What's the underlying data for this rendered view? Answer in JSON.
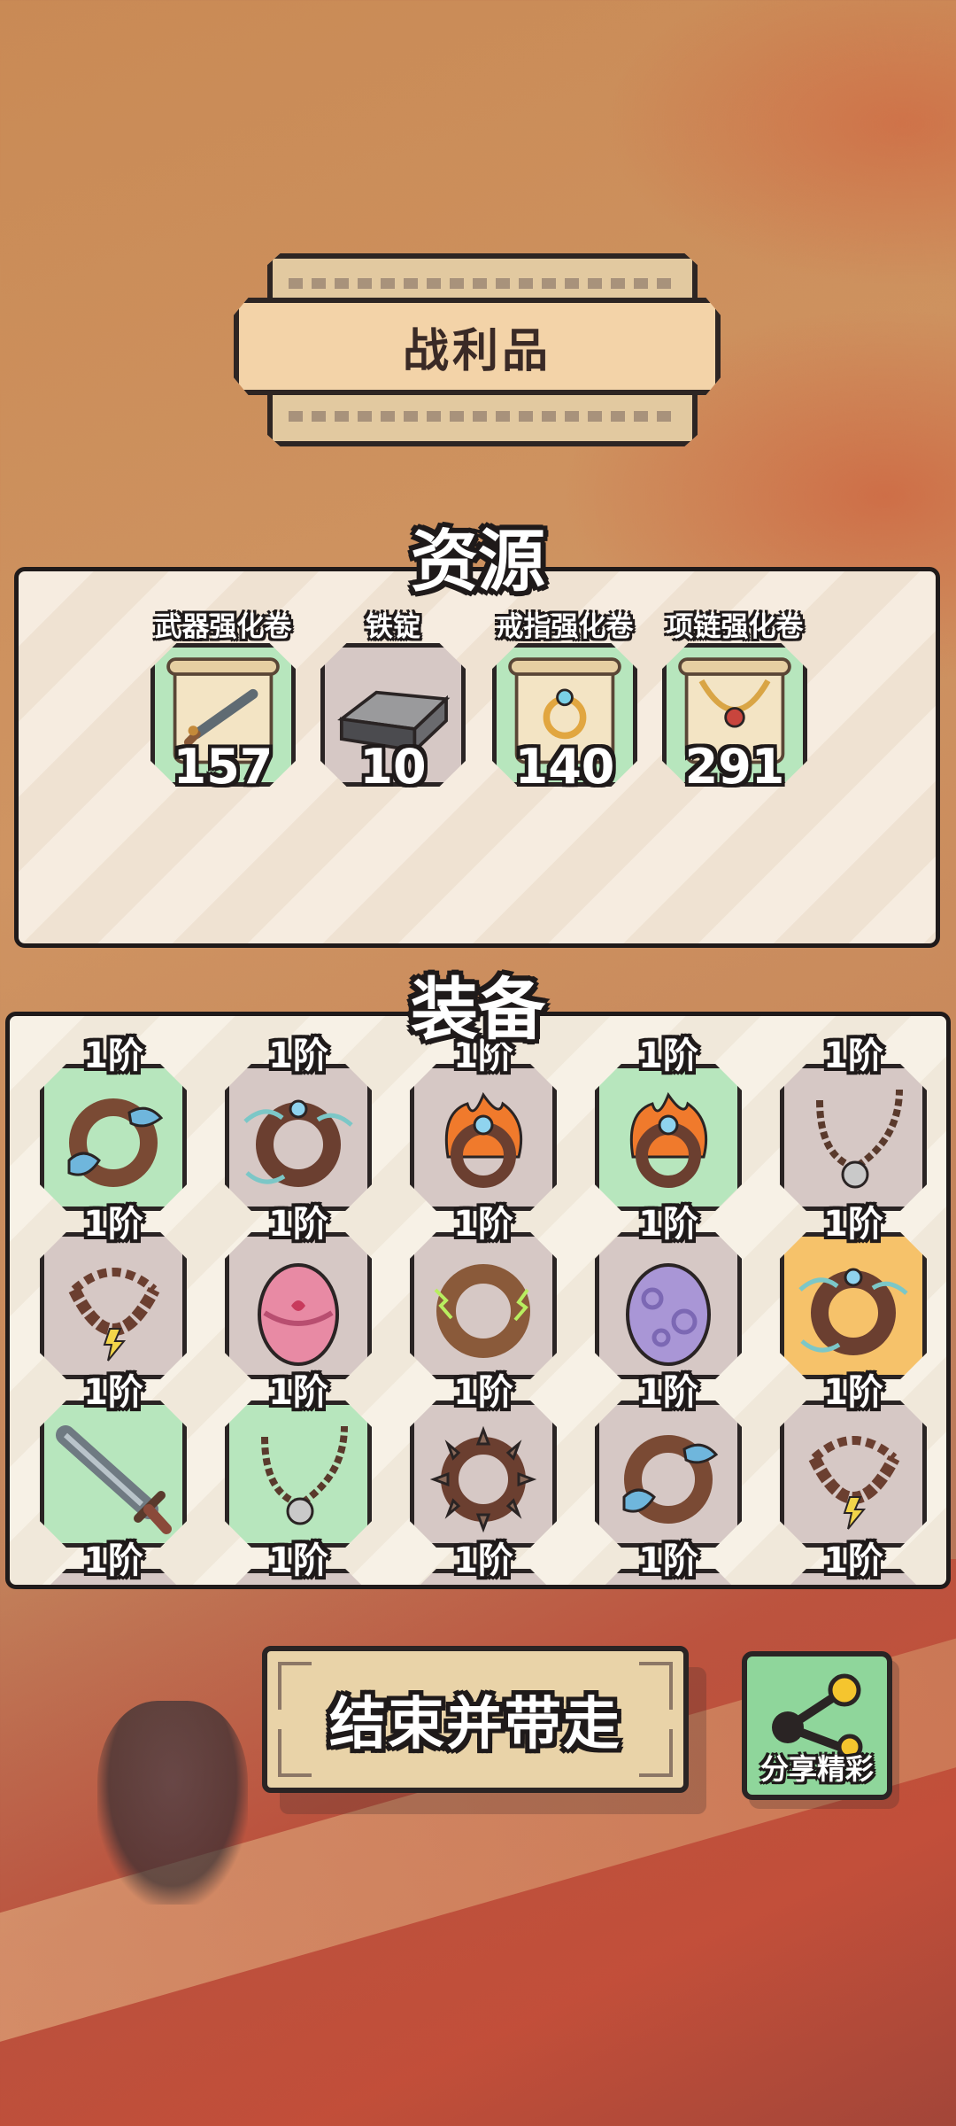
{
  "banner": {
    "title": "战利品"
  },
  "resources": {
    "heading": "资源",
    "items": [
      {
        "label": "武器强化卷",
        "count": "157",
        "icon": "weapon-scroll-icon",
        "bg": "#b7e6bd"
      },
      {
        "label": "铁锭",
        "count": "10",
        "icon": "iron-ingot-icon",
        "bg": "#d6c8c5"
      },
      {
        "label": "戒指强化卷",
        "count": "140",
        "icon": "ring-scroll-icon",
        "bg": "#b7e6bd"
      },
      {
        "label": "项链强化卷",
        "count": "291",
        "icon": "necklace-scroll-icon",
        "bg": "#b7e6bd"
      }
    ]
  },
  "equipment": {
    "heading": "装备",
    "items": [
      {
        "tier": "1阶",
        "icon": "water-ring-icon",
        "bg": "green"
      },
      {
        "tier": "1阶",
        "icon": "wind-ring-icon",
        "bg": "grey"
      },
      {
        "tier": "1阶",
        "icon": "fire-ring-icon",
        "bg": "grey"
      },
      {
        "tier": "1阶",
        "icon": "fire-ring-icon",
        "bg": "green"
      },
      {
        "tier": "1阶",
        "icon": "saw-necklace-icon",
        "bg": "grey"
      },
      {
        "tier": "1阶",
        "icon": "lightning-beads-icon",
        "bg": "grey"
      },
      {
        "tier": "1阶",
        "icon": "pink-egg-icon",
        "bg": "grey"
      },
      {
        "tier": "1阶",
        "icon": "thunder-ring-icon",
        "bg": "grey"
      },
      {
        "tier": "1阶",
        "icon": "purple-egg-icon",
        "bg": "grey"
      },
      {
        "tier": "1阶",
        "icon": "wind-ring-icon",
        "bg": "orange"
      },
      {
        "tier": "1阶",
        "icon": "sword-icon",
        "bg": "green"
      },
      {
        "tier": "1阶",
        "icon": "saw-necklace-icon",
        "bg": "green"
      },
      {
        "tier": "1阶",
        "icon": "spike-ring-icon",
        "bg": "grey"
      },
      {
        "tier": "1阶",
        "icon": "water-ring-icon",
        "bg": "grey"
      },
      {
        "tier": "1阶",
        "icon": "lightning-beads-icon",
        "bg": "grey"
      },
      {
        "tier": "1阶",
        "icon": "",
        "bg": "grey"
      },
      {
        "tier": "1阶",
        "icon": "",
        "bg": "grey"
      },
      {
        "tier": "1阶",
        "icon": "",
        "bg": "grey"
      },
      {
        "tier": "1阶",
        "icon": "",
        "bg": "grey"
      },
      {
        "tier": "1阶",
        "icon": "",
        "bg": "grey"
      }
    ]
  },
  "buttons": {
    "end_label": "结束并带走",
    "share_label": "分享精彩"
  }
}
